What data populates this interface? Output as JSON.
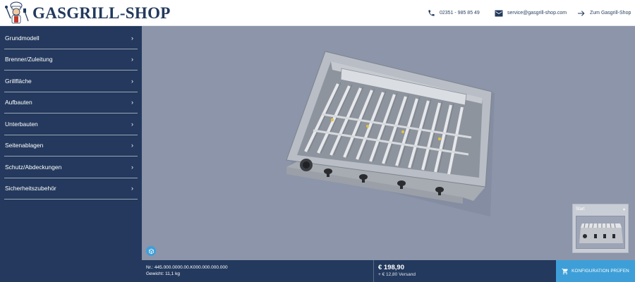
{
  "header": {
    "logo_text": "GASGRILL-SHOP",
    "phone": "02351 - 985 85 49",
    "email": "service@gasgrill-shop.com",
    "shop_link": "Zum Gasgrill-Shop"
  },
  "sidebar": {
    "items": [
      {
        "label": "Grundmodell"
      },
      {
        "label": "Brenner/Zuleitung"
      },
      {
        "label": "Grillfläche"
      },
      {
        "label": "Aufbauten"
      },
      {
        "label": "Unterbauten"
      },
      {
        "label": "Seitenablagen"
      },
      {
        "label": "Schutz/Abdeckungen"
      },
      {
        "label": "Sicherheitszubehör"
      }
    ]
  },
  "viewer": {
    "ar_icon": "cube-icon",
    "view_select": {
      "selected": "Start"
    }
  },
  "footer": {
    "article_number": "Nr.: 445.000.0000.00.K000.000.000.000",
    "weight": "Gewicht: 11,1 kg",
    "price": "€ 198,90",
    "shipping": "+ € 12,80 Versand",
    "check_button": "KONFIGURATION PRÜFEN"
  },
  "colors": {
    "navy": "#23395d",
    "accent": "#3e9fd8",
    "viewport_bg": "#8c95a9"
  }
}
